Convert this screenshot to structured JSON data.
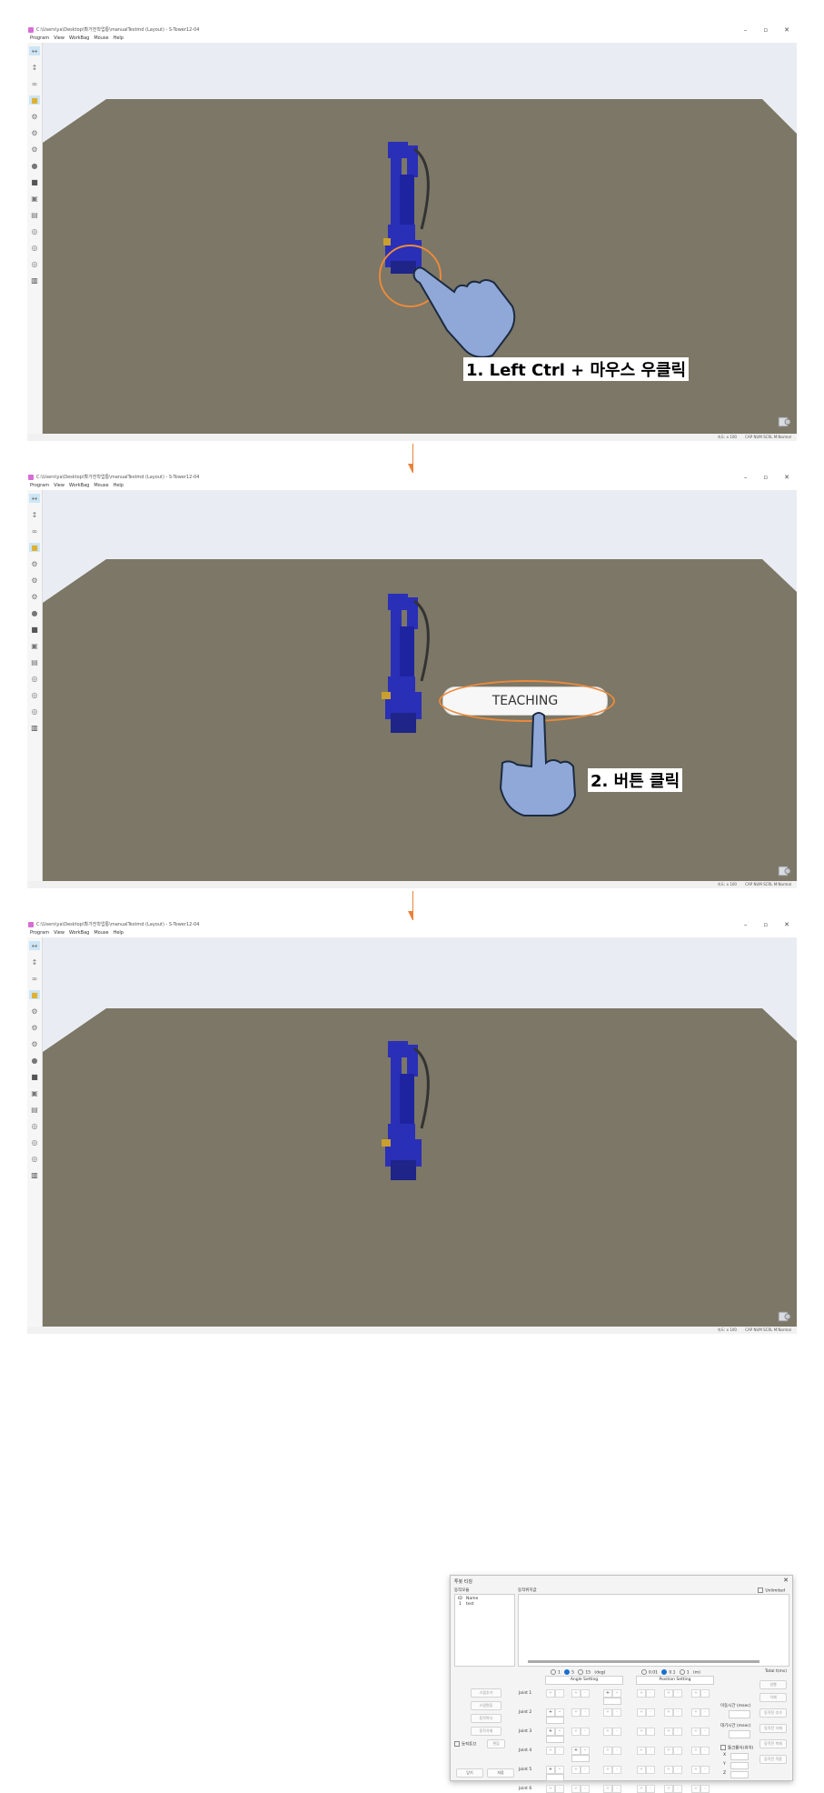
{
  "window": {
    "title": "C:\\Users\\ya\\Desktop\\확가전학업통\\manualTestmd (Layout) - S-Tower12-04",
    "menu": [
      "Program",
      "View",
      "WorkBag",
      "Mouse",
      "Help"
    ],
    "controls": [
      "–",
      "▫",
      "✕"
    ]
  },
  "statusbar": {
    "speed": "속도: x 100",
    "indicators": "CAP NUM SCRL M:Normal"
  },
  "steps": {
    "step1": "1. Left Ctrl + 마우스 우클릭",
    "step2": "2. 버튼 클릭"
  },
  "context_menu": {
    "item": "TEACHING"
  },
  "dialog": {
    "title": "투봇 티칭",
    "close": "✕",
    "left_header": "동작모듈",
    "right_header": "동작위치값",
    "unlimited": "Unlimited",
    "list_columns": [
      "ID",
      "Name"
    ],
    "list_rows": [
      {
        "id": "1",
        "name": "test"
      }
    ],
    "side_buttons": [
      "스텝추가",
      "스텝편집",
      "동작복사",
      "동작삭제"
    ],
    "checkbox_label": "동작튜브",
    "small_button": "편집",
    "angle_steps": [
      "1",
      "5",
      "15",
      "(deg)"
    ],
    "angle_selected": "5",
    "position_steps": [
      "0.01",
      "0.1",
      "1",
      "(m)"
    ],
    "position_selected": "0.1",
    "angle_header": "Angle Setting",
    "position_header": "Position Setting",
    "joints": [
      "Joint 1",
      "Joint 2",
      "Joint 3",
      "Joint 4",
      "Joint 5",
      "Joint 6"
    ],
    "total": "Total t(ms)",
    "right_buttons": [
      "실행",
      "삭제",
      "동작전 추가",
      "동작전 삭제",
      "동작전 복제",
      "동작전 적용"
    ],
    "move_time": "이동시간 (msec)",
    "wait_time": "대기시간 (msec)",
    "tool_label": "툴크롤식(위치)",
    "axes": [
      "X",
      "Y",
      "Z"
    ],
    "bottom_buttons": [
      "닫기",
      "저장"
    ]
  },
  "colors": {
    "floor": "#7c7766",
    "accent": "#e8823a",
    "robot": "#2a2fb8",
    "hand": "#8fa8d8"
  }
}
